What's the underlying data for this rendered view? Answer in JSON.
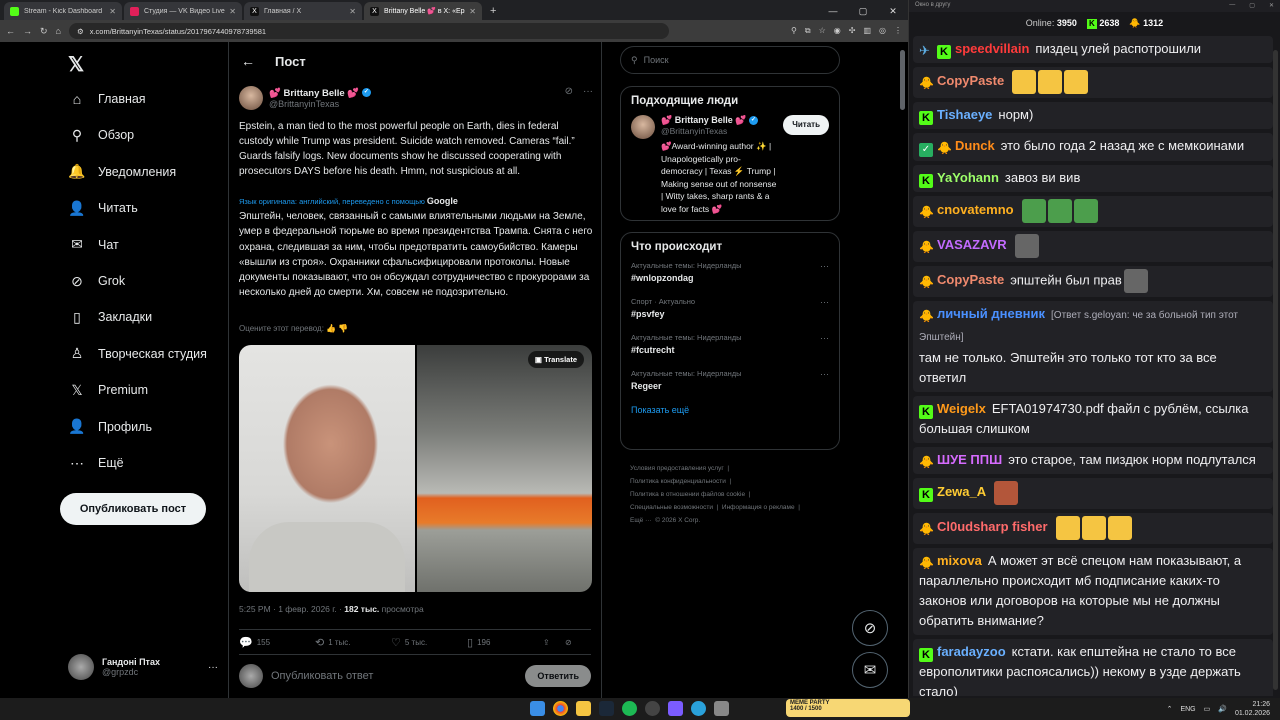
{
  "browser": {
    "tabs": [
      {
        "title": "Stream - Kick Dashboard",
        "color": "#53fc18"
      },
      {
        "title": "Студия — VK Видео Live",
        "color": "#e0205a"
      },
      {
        "title": "Главная / X",
        "color": "#111111"
      },
      {
        "title": "Brittany Belle 💕 в X: «Epst",
        "color": "#111111"
      }
    ],
    "url": "x.com/BrittanyinTexas/status/2017967440978739581"
  },
  "nav": {
    "items": [
      {
        "label": "Главная",
        "icon": "home-icon",
        "glyph": "⌂"
      },
      {
        "label": "Обзор",
        "icon": "search-icon",
        "glyph": "⚲"
      },
      {
        "label": "Уведомления",
        "icon": "bell-icon",
        "glyph": "🔔"
      },
      {
        "label": "Читать",
        "icon": "follow-icon",
        "glyph": "👤"
      },
      {
        "label": "Чат",
        "icon": "mail-icon",
        "glyph": "✉"
      },
      {
        "label": "Grok",
        "icon": "grok-icon",
        "glyph": "⊘"
      },
      {
        "label": "Закладки",
        "icon": "bookmark-icon",
        "glyph": "▯"
      },
      {
        "label": "Творческая студия",
        "icon": "studio-icon",
        "glyph": "♙"
      },
      {
        "label": "Premium",
        "icon": "x-premium-icon",
        "glyph": "𝕏"
      },
      {
        "label": "Профиль",
        "icon": "profile-icon",
        "glyph": "👤"
      },
      {
        "label": "Ещё",
        "icon": "more-icon",
        "glyph": "⋯"
      }
    ],
    "post_button": "Опубликовать пост",
    "account_name": "Гандоні Птах",
    "account_handle": "@grpzdc"
  },
  "post": {
    "header": "Пост",
    "author_name": "💕 Brittany Belle 💕",
    "author_handle": "@BrittanyinTexas",
    "text": "Epstein, a man tied to the most powerful people on Earth, dies in federal custody while Trump was president. Suicide watch removed. Cameras “fail.” Guards falsify logs. New documents show he discussed cooperating with prosecutors DAYS before his death. Hmm, not suspicious at all.",
    "translation_note": "Язык оригинала: английский, переведено с помощью",
    "translation_provider": "Google",
    "translated_text": "Эпштейн, человек, связанный с самыми влиятельными людьми на Земле, умер в федеральной тюрьме во время президентства Трампа. Снята с него охрана, следившая за ним, чтобы предотвратить самоубийство. Камеры «вышли из строя». Охранники сфальсифицировали протоколы. Новые документы показывают, что он обсуждал сотрудничество с прокурорами за несколько дней до смерти. Хм, совсем не подозрительно.",
    "rate_translation": "Оцените этот перевод:",
    "media_translate": "Translate",
    "time": "5:25 PM · 1 февр. 2026 г. · ",
    "views_count": "182 тыс.",
    "views_label": " просмотра",
    "stats": {
      "replies": "155",
      "reposts": "1 тыс.",
      "likes": "5 тыс.",
      "bookmarks": "196"
    },
    "reply_placeholder": "Опубликовать ответ",
    "reply_button": "Ответить"
  },
  "sidebar": {
    "search_placeholder": "Поиск",
    "people_title": "Подходящие люди",
    "person": {
      "name": "💕 Brittany Belle 💕",
      "handle": "@BrittanyinTexas",
      "bio": "💕Award-winning author ✨ | Unapologetically pro-democracy | Texas ⚡ Trump | Making sense out of nonsense | Witty takes, sharp rants & a love for facts 💕",
      "follow": "Читать"
    },
    "trends_title": "Что происходит",
    "trends": [
      {
        "context": "Актуальные темы: Нидерланды",
        "tag": "#wnlopzondag"
      },
      {
        "context": "Спорт · Актуально",
        "tag": "#psvfey"
      },
      {
        "context": "Актуальные темы: Нидерланды",
        "tag": "#fcutrecht"
      },
      {
        "context": "Актуальные темы: Нидерланды",
        "tag": "Regeer"
      }
    ],
    "show_more": "Показать ещё",
    "footer": [
      "Условия предоставления услуг",
      "Политика конфиденциальности",
      "Политика в отношении файлов cookie",
      "Специальные возможности",
      "Информация о рекламе",
      "Ещё ···",
      "© 2026 X Corp."
    ]
  },
  "chat": {
    "window_title": "Окно в другу",
    "online_label": "Online:",
    "online_count": "3950",
    "kick_count": "2638",
    "other_count": "1312",
    "messages": [
      {
        "user": "speedvillain",
        "color": "#ff3b3b",
        "text": "пиздец улей распотрошили",
        "badges": [
          "s",
          "k"
        ]
      },
      {
        "user": "CopyPaste",
        "color": "#f08a6e",
        "text": "",
        "badges": [
          "c"
        ],
        "emotes": 3,
        "emote_color": "#f5c542"
      },
      {
        "user": "Tishaeye",
        "color": "#6ab0ff",
        "text": "норм)",
        "badges": [
          "k"
        ]
      },
      {
        "user": "Dunck",
        "color": "#ff8c1a",
        "text": "это было года 2 назад же с мемкоинами",
        "badges": [
          "g",
          "c"
        ]
      },
      {
        "user": "YaYohann",
        "color": "#9dff6a",
        "text": "завоз ви вив",
        "badges": [
          "k"
        ]
      },
      {
        "user": "cnovatemno",
        "color": "#ffb020",
        "text": "",
        "badges": [
          "c"
        ],
        "emotes": 3,
        "emote_color": "#4c9e4c"
      },
      {
        "user": "VASAZAVR",
        "color": "#c36bff",
        "text": "",
        "badges": [
          "c"
        ],
        "emotes": 1,
        "emote_color": "#666666"
      },
      {
        "user": "CopyPaste",
        "color": "#f08a6e",
        "text": "эпштейн был прав",
        "badges": [
          "c"
        ],
        "emotes": 1,
        "emote_color": "#666666"
      },
      {
        "user": "личный дневник",
        "color": "#4a90ff",
        "text": "там не только. Эпштейн это только тот кто за все ответил",
        "reply": "[Ответ s.geloyan: че за больной тип этот Эпштейн]",
        "badges": [
          "c"
        ]
      },
      {
        "user": "Weigelx",
        "color": "#ff9a1a",
        "text": "EFTA01974730.pdf файл с рублём, ссылка большая слишком",
        "badges": [
          "k"
        ]
      },
      {
        "user": "ШУЕ ППШ",
        "color": "#d66bff",
        "text": "это старое, там пиздюк норм подлутался",
        "badges": [
          "c"
        ]
      },
      {
        "user": "Zewa_A",
        "color": "#ffcc33",
        "text": "",
        "badges": [
          "k"
        ],
        "emotes": 1,
        "emote_color": "#b3563a"
      },
      {
        "user": "Cl0udsharp fisher",
        "color": "#ff6b6b",
        "text": "",
        "badges": [
          "c"
        ],
        "emotes": 3,
        "emote_color": "#f5c542"
      },
      {
        "user": "mixova",
        "color": "#ffb020",
        "text": "А может эт всё спецом нам показывают, а параллельно происходит мб подписание каких-то законов или договоров на которые мы не должны обратить внимание?",
        "badges": [
          "c"
        ]
      },
      {
        "user": "faradayzoo",
        "color": "#6ab0ff",
        "text": "кстати. как епштейна не стало то все европолитики распоясались)) некому в узде держать стало)",
        "badges": [
          "k"
        ]
      }
    ]
  },
  "taskbar": {
    "meme_label": "MEME PARTY",
    "meme_progress": "1400 / 1500",
    "lang": "ENG",
    "time": "21:26",
    "date": "01.02.2026"
  }
}
